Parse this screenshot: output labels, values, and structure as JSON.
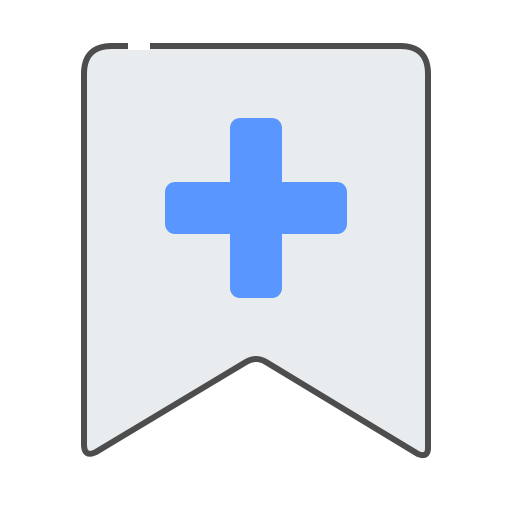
{
  "icon": {
    "name": "bookmark-add-icon",
    "colors": {
      "fill": "#e9ecef",
      "stroke": "#4d4d4d",
      "plus": "#5a96ff",
      "background": "#ffffff"
    }
  }
}
